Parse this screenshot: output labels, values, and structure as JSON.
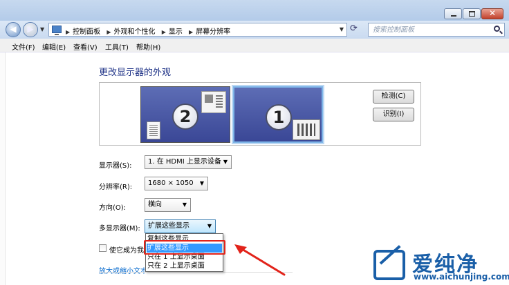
{
  "address": {
    "crumbs": [
      "控制面板",
      "外观和个性化",
      "显示",
      "屏幕分辨率"
    ],
    "search_placeholder": "搜索控制面板"
  },
  "menu": [
    "文件(F)",
    "编辑(E)",
    "查看(V)",
    "工具(T)",
    "帮助(H)"
  ],
  "main": {
    "heading": "更改显示器的外观",
    "monitors": [
      {
        "number": "2"
      },
      {
        "number": "1"
      }
    ],
    "detect_button": "检测(C)",
    "identify_button": "识别(I)",
    "display_label": "显示器(S):",
    "display_value": "1. 在 HDMI 上显示设备",
    "resolution_label": "分辨率(R):",
    "resolution_value": "1680 × 1050",
    "orientation_label": "方向(O):",
    "orientation_value": "横向",
    "multi_label": "多显示器(M):",
    "multi_value": "扩展这些显示",
    "multi_options": [
      "复制这些显示",
      "扩展这些显示",
      "只在 1 上显示桌面",
      "只在 2 上显示桌面"
    ],
    "checkbox_label": "使它成为我的主显示器",
    "link_text": "放大或缩小文本和其他项目"
  },
  "watermark": {
    "brand": "爱纯净",
    "url": "www.aichunjing.com"
  },
  "colors": {
    "accent_highlight": "#3399ff",
    "annotation_red": "#e2231a",
    "logo_blue": "#1a5fa8"
  }
}
